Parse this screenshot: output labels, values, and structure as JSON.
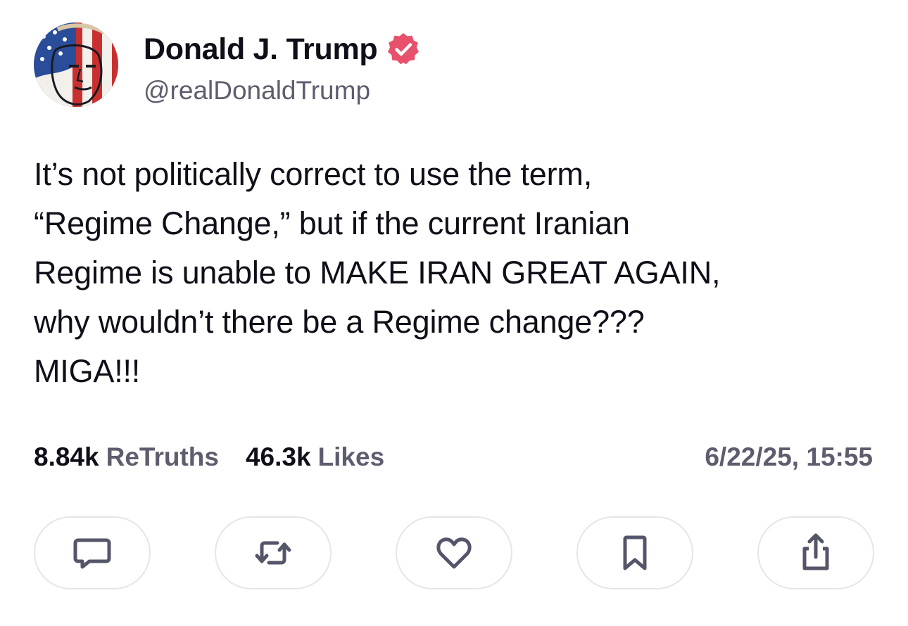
{
  "author": {
    "display_name": "Donald J. Trump",
    "handle": "@realDonaldTrump",
    "verified_color": "#e8516b"
  },
  "post": {
    "text": "It’s not politically correct to use the term,\n“Regime Change,” but if the current Iranian\nRegime is unable to MAKE IRAN GREAT AGAIN,\nwhy wouldn’t there be a Regime change???\nMIGA!!!"
  },
  "stats": {
    "retruths_value": "8.84k",
    "retruths_label": "ReTruths",
    "likes_value": "46.3k",
    "likes_label": "Likes"
  },
  "timestamp": "6/22/25, 15:55",
  "actions": [
    {
      "icon": "comment-icon"
    },
    {
      "icon": "retruth-icon"
    },
    {
      "icon": "heart-icon"
    },
    {
      "icon": "bookmark-icon"
    },
    {
      "icon": "share-icon"
    }
  ],
  "colors": {
    "text_primary": "#0f0f19",
    "text_secondary": "#5d5d6e",
    "icon": "#55556a",
    "button_border": "#e5e5ea"
  }
}
